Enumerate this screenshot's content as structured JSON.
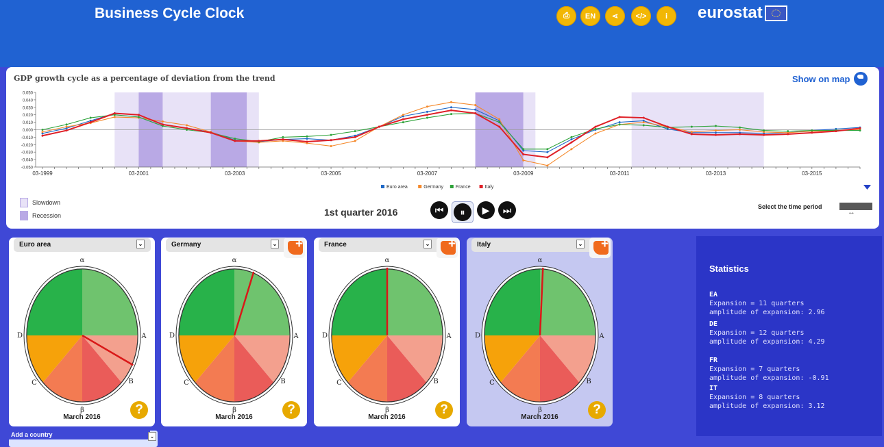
{
  "header": {
    "title": "Business Cycle Clock",
    "brand": "eurostat",
    "icons": [
      {
        "name": "pdf-icon",
        "glyph": "⎙"
      },
      {
        "name": "language-icon",
        "glyph": "EN"
      },
      {
        "name": "share-icon",
        "glyph": "⋖"
      },
      {
        "name": "embed-icon",
        "glyph": "</>"
      },
      {
        "name": "info-icon",
        "glyph": "i"
      }
    ]
  },
  "chart": {
    "title": "GDP growth cycle as a percentage of deviation from the trend",
    "show_map_label": "Show on map"
  },
  "chart_data": {
    "type": "line",
    "x": [
      "03-1999",
      "09-1999",
      "03-2000",
      "09-2000",
      "03-2001",
      "09-2001",
      "03-2002",
      "09-2002",
      "03-2003",
      "09-2003",
      "03-2004",
      "09-2004",
      "03-2005",
      "09-2005",
      "03-2006",
      "09-2006",
      "03-2007",
      "09-2007",
      "03-2008",
      "09-2008",
      "03-2009",
      "09-2009",
      "03-2010",
      "09-2010",
      "03-2011",
      "09-2011",
      "03-2012",
      "09-2012",
      "03-2013",
      "09-2013",
      "03-2014",
      "09-2014",
      "03-2015",
      "09-2015",
      "03-2016"
    ],
    "series": [
      {
        "name": "Euro area",
        "values": [
          -0.005,
          0.002,
          0.012,
          0.022,
          0.02,
          0.007,
          0.002,
          -0.003,
          -0.014,
          -0.016,
          -0.013,
          -0.012,
          -0.014,
          -0.008,
          0.004,
          0.018,
          0.024,
          0.03,
          0.027,
          0.012,
          -0.028,
          -0.03,
          -0.013,
          0.0,
          0.01,
          0.012,
          0.001,
          -0.004,
          -0.004,
          -0.004,
          -0.005,
          -0.004,
          -0.001,
          0.001,
          0.003
        ]
      },
      {
        "name": "Germany",
        "values": [
          -0.003,
          0.004,
          0.009,
          0.017,
          0.016,
          0.011,
          0.006,
          -0.003,
          -0.015,
          -0.017,
          -0.015,
          -0.018,
          -0.022,
          -0.015,
          0.004,
          0.02,
          0.031,
          0.037,
          0.033,
          0.014,
          -0.041,
          -0.048,
          -0.026,
          -0.005,
          0.007,
          0.01,
          0.004,
          -0.003,
          -0.001,
          0.0,
          -0.003,
          -0.004,
          -0.002,
          -0.001,
          0.0
        ]
      },
      {
        "name": "France",
        "values": [
          0.0,
          0.007,
          0.016,
          0.02,
          0.017,
          0.005,
          0.0,
          -0.004,
          -0.012,
          -0.016,
          -0.01,
          -0.009,
          -0.007,
          -0.002,
          0.004,
          0.01,
          0.016,
          0.021,
          0.022,
          0.01,
          -0.026,
          -0.026,
          -0.01,
          0.001,
          0.007,
          0.006,
          0.003,
          0.004,
          0.005,
          0.003,
          -0.001,
          -0.002,
          -0.001,
          -0.001,
          -0.001
        ]
      },
      {
        "name": "Italy",
        "values": [
          -0.008,
          -0.001,
          0.01,
          0.022,
          0.02,
          0.007,
          0.002,
          -0.004,
          -0.015,
          -0.015,
          -0.013,
          -0.016,
          -0.014,
          -0.01,
          0.004,
          0.014,
          0.02,
          0.026,
          0.022,
          0.004,
          -0.033,
          -0.037,
          -0.017,
          0.004,
          0.017,
          0.016,
          0.004,
          -0.006,
          -0.007,
          -0.006,
          -0.007,
          -0.006,
          -0.004,
          -0.002,
          0.002
        ]
      }
    ],
    "ylim": [
      -0.05,
      0.05
    ],
    "y_ticks": [
      "0.050",
      "0.040",
      "0.030",
      "0.020",
      "0.010",
      "0.000",
      "-0.010",
      "-0.020",
      "-0.030",
      "-0.040",
      "-0.050"
    ],
    "x_tick_labels": [
      "03-1999",
      "03-2001",
      "03-2003",
      "03-2005",
      "03-2007",
      "03-2009",
      "03-2011",
      "03-2013",
      "03-2015"
    ],
    "bands": [
      {
        "type": "slowdown",
        "from": "09-2000",
        "to": "03-2001"
      },
      {
        "type": "recession",
        "from": "03-2001",
        "to": "09-2001"
      },
      {
        "type": "slowdown",
        "from": "09-2001",
        "to": "09-2002"
      },
      {
        "type": "recession",
        "from": "09-2002",
        "to": "06-2003"
      },
      {
        "type": "slowdown",
        "from": "06-2003",
        "to": "09-2003"
      },
      {
        "type": "recession",
        "from": "03-2008",
        "to": "03-2009"
      },
      {
        "type": "slowdown",
        "from": "03-2009",
        "to": "06-2009"
      },
      {
        "type": "slowdown",
        "from": "06-2011",
        "to": "03-2014"
      }
    ],
    "grid": false,
    "legend_position": "bottom"
  },
  "chart_colors": {
    "Euro area": "#1f69c7",
    "Germany": "#f5892b",
    "France": "#2ea33a",
    "Italy": "#df1f26",
    "slowdown": "#e8e2f7",
    "recession": "#b9a9e5"
  },
  "legend": {
    "slowdown": "Slowdown",
    "recession": "Recession"
  },
  "timeline": {
    "quarter": "1st quarter 2016",
    "select_time_label": "Select the time period",
    "buttons": [
      "⏮",
      "⏸",
      "▶",
      "⏭"
    ]
  },
  "clocks": [
    {
      "country": "Euro area",
      "date": "March 2016",
      "hand_angle": 116,
      "alpha": "α",
      "beta": "β",
      "a": "A",
      "b": "B",
      "c": "C",
      "d": "D",
      "help": "?"
    },
    {
      "country": "Germany",
      "date": "March 2016",
      "hand_angle": 20,
      "alpha": "α",
      "beta": "β",
      "a": "A",
      "b": "B",
      "c": "C",
      "d": "D",
      "help": "?"
    },
    {
      "country": "France",
      "date": "March 2016",
      "hand_angle": 0,
      "alpha": "α",
      "beta": "β",
      "a": "A",
      "b": "B",
      "c": "C",
      "d": "D",
      "help": "?"
    },
    {
      "country": "Italy",
      "date": "March 2016",
      "hand_angle": 3,
      "alpha": "α",
      "beta": "β",
      "a": "A",
      "b": "B",
      "c": "C",
      "d": "D",
      "help": "?"
    }
  ],
  "add_country": {
    "label": "Add a country"
  },
  "statistics": {
    "title": "Statistics",
    "items": [
      {
        "code": "EA",
        "expansion": "Expansion = 11 quarters",
        "amplitude": "amplitude of expansion: 2.96"
      },
      {
        "code": "DE",
        "expansion": "Expansion = 12 quarters",
        "amplitude": "amplitude of expansion: 4.29"
      },
      {
        "code": "FR",
        "expansion": "Expansion = 7 quarters",
        "amplitude": "amplitude of expansion: -0.91"
      },
      {
        "code": "IT",
        "expansion": "Expansion = 8 quarters",
        "amplitude": "amplitude of expansion: 3.12"
      }
    ]
  }
}
